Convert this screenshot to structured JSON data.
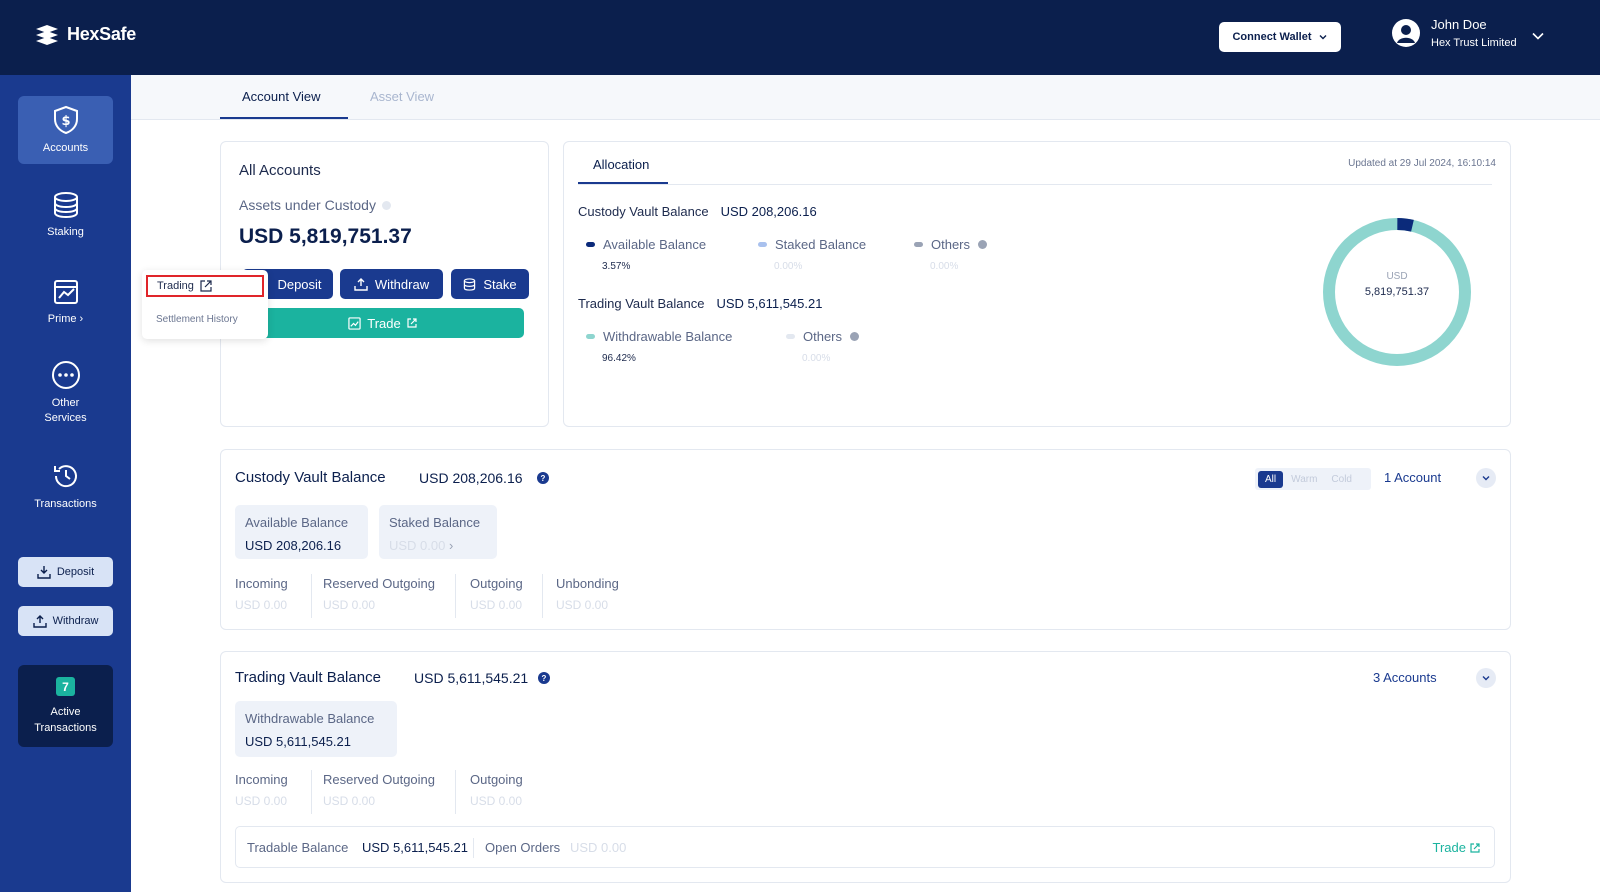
{
  "header": {
    "logo_text": "HexSafe",
    "connect_wallet_label": "Connect Wallet",
    "user_name": "John Doe",
    "user_org": "Hex Trust Limited"
  },
  "sidebar": {
    "items": [
      {
        "label": "Accounts",
        "icon": "shield-dollar-icon"
      },
      {
        "label": "Staking",
        "icon": "database-icon"
      },
      {
        "label": "Prime",
        "icon": "chart-icon"
      },
      {
        "label": "Other Services",
        "icon": "more-icon"
      },
      {
        "label": "Transactions",
        "icon": "history-icon"
      }
    ],
    "deposit_label": "Deposit",
    "withdraw_label": "Withdraw",
    "active_tx_count": "7",
    "active_tx_label": "Active Transactions"
  },
  "tabs": [
    "Account View",
    "Asset View"
  ],
  "all_accounts": {
    "title": "All Accounts",
    "subtitle": "Assets under Custody",
    "amount": "USD 5,819,751.37",
    "deposit_label": "Deposit",
    "withdraw_label": "Withdraw",
    "stake_label": "Stake",
    "trade_label": "Trade"
  },
  "popup": {
    "trading_label": "Trading",
    "settlement_label": "Settlement History"
  },
  "allocation": {
    "tab_label": "Allocation",
    "updated": "Updated at 29 Jul 2024, 16:10:14",
    "custody_title": "Custody Vault Balance",
    "custody_amount": "USD 208,206.16",
    "custody_legend": [
      {
        "label": "Available Balance",
        "value": "3.57%",
        "color": "#0b2a7a"
      },
      {
        "label": "Staked Balance",
        "value": "0.00%",
        "color": "#a9c1ee"
      },
      {
        "label": "Others",
        "value": "0.00%",
        "color": "#9aa3b5"
      }
    ],
    "trading_title": "Trading Vault Balance",
    "trading_amount": "USD 5,611,545.21",
    "trading_legend": [
      {
        "label": "Withdrawable Balance",
        "value": "96.42%",
        "color": "#8ed5cf"
      },
      {
        "label": "Others",
        "value": "0.00%",
        "color": "#e3e8f0"
      }
    ],
    "donut_currency": "USD",
    "donut_amount": "5,819,751.37",
    "donut_share_custody": 0.0357,
    "donut_share_trading": 0.9642
  },
  "custody_card": {
    "title": "Custody Vault Balance",
    "amount": "USD 208,206.16",
    "segments": [
      "All",
      "Warm",
      "Cold"
    ],
    "account_count": "1 Account",
    "available_label": "Available Balance",
    "available_value": "USD 208,206.16",
    "staked_label": "Staked Balance",
    "staked_value": "USD 0.00",
    "stats": [
      {
        "label": "Incoming",
        "value": "USD 0.00"
      },
      {
        "label": "Reserved Outgoing",
        "value": "USD 0.00"
      },
      {
        "label": "Outgoing",
        "value": "USD 0.00"
      },
      {
        "label": "Unbonding",
        "value": "USD 0.00"
      }
    ]
  },
  "trading_card": {
    "title": "Trading Vault Balance",
    "amount": "USD 5,611,545.21",
    "account_count": "3 Accounts",
    "withdrawable_label": "Withdrawable Balance",
    "withdrawable_value": "USD 5,611,545.21",
    "stats": [
      {
        "label": "Incoming",
        "value": "USD 0.00"
      },
      {
        "label": "Reserved Outgoing",
        "value": "USD 0.00"
      },
      {
        "label": "Outgoing",
        "value": "USD 0.00"
      }
    ],
    "tradable_label": "Tradable Balance",
    "tradable_value": "USD 5,611,545.21",
    "open_orders_label": "Open Orders",
    "open_orders_value": "USD 0.00",
    "trade_label": "Trade"
  }
}
